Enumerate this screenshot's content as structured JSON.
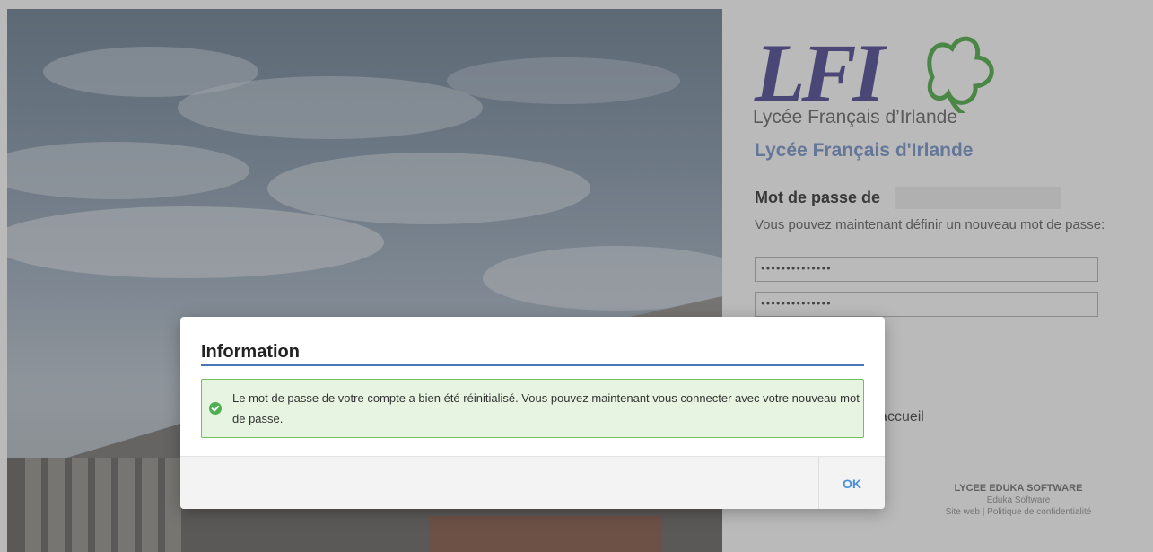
{
  "background": {
    "icon": "school-building-photo"
  },
  "panel": {
    "logo": {
      "letters": "LFI",
      "subtitle": "Lycée Français d’Irlande",
      "icon": "shamrock-logo-icon"
    },
    "school_name": "Lycée Français d'Irlande",
    "password_heading": "Mot de passe de",
    "instruction": "Vous pouvez maintenant définir un nouveau mot de passe:",
    "password_value": "••••••••••••••",
    "password_confirm_value": "••••••••••••••",
    "home_link_partial": "'accueil",
    "footer": {
      "brand": "LYCEE EDUKA SOFTWARE",
      "company": "Eduka Software",
      "links": "Site web | Politique de confidentialité"
    }
  },
  "modal": {
    "title": "Information",
    "message": "Le mot de passe de votre compte a bien été réinitialisé. Vous pouvez maintenant vous connecter avec votre nouveau mot de passe.",
    "ok_label": "OK",
    "icon": "check-circle-icon"
  },
  "colors": {
    "accent_blue": "#4a78b6",
    "school_name": "#6b8cc6",
    "success_border": "#71c05a",
    "success_bg": "#e6f4e1",
    "ok_button": "#4a90d9",
    "logo_purple": "#3e3a8c",
    "logo_green": "#3fa536"
  }
}
